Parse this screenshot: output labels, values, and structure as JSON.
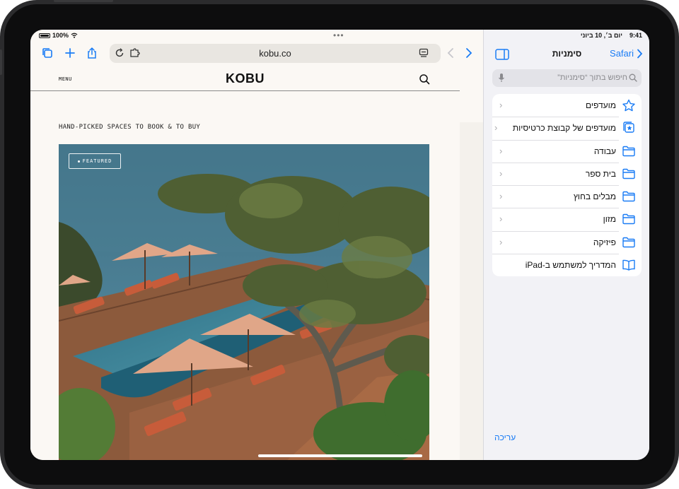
{
  "device": {
    "frame_color": "#2b2b2d",
    "accent": "#1a7cf5"
  },
  "safari": {
    "status": {
      "battery": "100%"
    },
    "address": {
      "url": "kobu.co"
    },
    "icons": [
      "tabs-overview-icon",
      "new-tab-icon",
      "share-icon",
      "reload-icon",
      "extensions-icon",
      "reader-icon",
      "back-icon",
      "forward-icon"
    ]
  },
  "site": {
    "menu_label": "MENU",
    "logo": "KOBU",
    "tagline": "HAND-PICKED SPACES TO BOOK & TO BUY",
    "featured_badge": "FEATURED"
  },
  "sidebar": {
    "status_time": "9:41",
    "status_date": "יום ב׳, 10 ביוני",
    "back_label": "Safari",
    "title": "סימניות",
    "search_placeholder": "חיפוש בתוך “סימניות”",
    "items": [
      {
        "label": "מועדפים",
        "icon": "star-icon",
        "chevron": true
      },
      {
        "label": "מועדפים של קבוצת כרטיסיות",
        "icon": "tab-group-star-icon",
        "chevron": true
      },
      {
        "label": "עבודה",
        "icon": "folder-icon",
        "chevron": true
      },
      {
        "label": "בית ספר",
        "icon": "folder-icon",
        "chevron": true
      },
      {
        "label": "מבלים בחוץ",
        "icon": "folder-icon",
        "chevron": true
      },
      {
        "label": "מזון",
        "icon": "folder-icon",
        "chevron": true
      },
      {
        "label": "פיזיקה",
        "icon": "folder-icon",
        "chevron": true
      },
      {
        "label": "המדריך למשתמש ב‑iPad",
        "icon": "book-icon",
        "chevron": false
      }
    ],
    "edit_label": "עריכה"
  }
}
